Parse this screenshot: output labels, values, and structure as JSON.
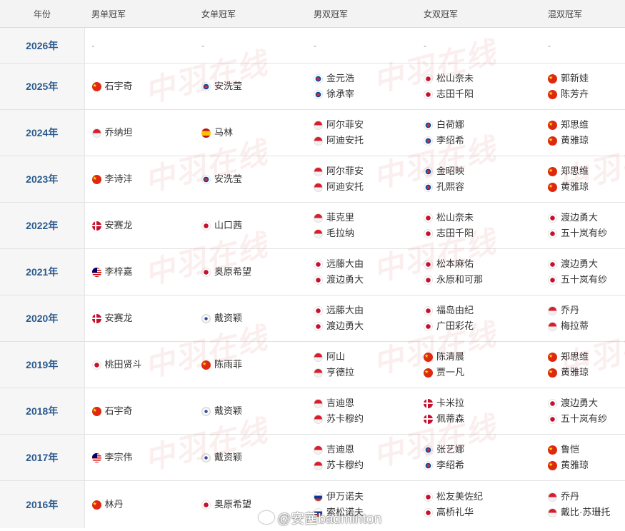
{
  "headers": [
    "年份",
    "男单冠军",
    "女单冠军",
    "男双冠军",
    "女双冠军",
    "混双冠军"
  ],
  "rows": [
    {
      "year": "2026年",
      "ms": "-",
      "ws": "-",
      "md": "-",
      "wd": "-",
      "xd": "-"
    },
    {
      "year": "2025年",
      "ms": {
        "flag": "cn",
        "name": "石宇奇"
      },
      "ws": {
        "flag": "kr",
        "name": "安洗莹"
      },
      "md": [
        {
          "flag": "kr",
          "name": "金元浩"
        },
        {
          "flag": "kr",
          "name": "徐承宰"
        }
      ],
      "wd": [
        {
          "flag": "jp",
          "name": "松山奈未"
        },
        {
          "flag": "jp",
          "name": "志田千阳"
        }
      ],
      "xd": [
        {
          "flag": "cn",
          "name": "郭新娃"
        },
        {
          "flag": "cn",
          "name": "陈芳卉"
        }
      ]
    },
    {
      "year": "2024年",
      "ms": {
        "flag": "id",
        "name": "乔纳坦"
      },
      "ws": {
        "flag": "es",
        "name": "马林"
      },
      "md": [
        {
          "flag": "id",
          "name": "阿尔菲安"
        },
        {
          "flag": "id",
          "name": "阿迪安托"
        }
      ],
      "wd": [
        {
          "flag": "kr",
          "name": "白荷娜"
        },
        {
          "flag": "kr",
          "name": "李绍希"
        }
      ],
      "xd": [
        {
          "flag": "cn",
          "name": "郑思维"
        },
        {
          "flag": "cn",
          "name": "黄雅琼"
        }
      ]
    },
    {
      "year": "2023年",
      "ms": {
        "flag": "cn",
        "name": "李诗沣"
      },
      "ws": {
        "flag": "kr",
        "name": "安洗莹"
      },
      "md": [
        {
          "flag": "id",
          "name": "阿尔菲安"
        },
        {
          "flag": "id",
          "name": "阿迪安托"
        }
      ],
      "wd": [
        {
          "flag": "kr",
          "name": "金昭映"
        },
        {
          "flag": "kr",
          "name": "孔熙容"
        }
      ],
      "xd": [
        {
          "flag": "cn",
          "name": "郑思维"
        },
        {
          "flag": "cn",
          "name": "黄雅琼"
        }
      ]
    },
    {
      "year": "2022年",
      "ms": {
        "flag": "dk",
        "name": "安赛龙"
      },
      "ws": {
        "flag": "jp",
        "name": "山口茜"
      },
      "md": [
        {
          "flag": "id",
          "name": "菲克里"
        },
        {
          "flag": "id",
          "name": "毛拉纳"
        }
      ],
      "wd": [
        {
          "flag": "jp",
          "name": "松山奈未"
        },
        {
          "flag": "jp",
          "name": "志田千阳"
        }
      ],
      "xd": [
        {
          "flag": "jp",
          "name": "渡边勇大"
        },
        {
          "flag": "jp",
          "name": "五十岚有纱"
        }
      ]
    },
    {
      "year": "2021年",
      "ms": {
        "flag": "my",
        "name": "李梓嘉"
      },
      "ws": {
        "flag": "jp",
        "name": "奥原希望"
      },
      "md": [
        {
          "flag": "jp",
          "name": "远藤大由"
        },
        {
          "flag": "jp",
          "name": "渡边勇大"
        }
      ],
      "wd": [
        {
          "flag": "jp",
          "name": "松本麻佑"
        },
        {
          "flag": "jp",
          "name": "永原和可那"
        }
      ],
      "xd": [
        {
          "flag": "jp",
          "name": "渡边勇大"
        },
        {
          "flag": "jp",
          "name": "五十岚有纱"
        }
      ]
    },
    {
      "year": "2020年",
      "ms": {
        "flag": "dk",
        "name": "安赛龙"
      },
      "ws": {
        "flag": "tp",
        "name": "戴资颖"
      },
      "md": [
        {
          "flag": "jp",
          "name": "远藤大由"
        },
        {
          "flag": "jp",
          "name": "渡边勇大"
        }
      ],
      "wd": [
        {
          "flag": "jp",
          "name": "福岛由纪"
        },
        {
          "flag": "jp",
          "name": "广田彩花"
        }
      ],
      "xd": [
        {
          "flag": "id",
          "name": "乔丹"
        },
        {
          "flag": "id",
          "name": "梅拉蒂"
        }
      ]
    },
    {
      "year": "2019年",
      "ms": {
        "flag": "jp",
        "name": "桃田贤斗"
      },
      "ws": {
        "flag": "cn",
        "name": "陈雨菲"
      },
      "md": [
        {
          "flag": "id",
          "name": "阿山"
        },
        {
          "flag": "id",
          "name": "亨德拉"
        }
      ],
      "wd": [
        {
          "flag": "cn",
          "name": "陈清晨"
        },
        {
          "flag": "cn",
          "name": "贾一凡"
        }
      ],
      "xd": [
        {
          "flag": "cn",
          "name": "郑思维"
        },
        {
          "flag": "cn",
          "name": "黄雅琼"
        }
      ]
    },
    {
      "year": "2018年",
      "ms": {
        "flag": "cn",
        "name": "石宇奇"
      },
      "ws": {
        "flag": "tp",
        "name": "戴资颖"
      },
      "md": [
        {
          "flag": "id",
          "name": "吉迪恩"
        },
        {
          "flag": "id",
          "name": "苏卡穆约"
        }
      ],
      "wd": [
        {
          "flag": "dk",
          "name": "卡米拉"
        },
        {
          "flag": "dk",
          "name": "佩蒂森"
        }
      ],
      "xd": [
        {
          "flag": "jp",
          "name": "渡边勇大"
        },
        {
          "flag": "jp",
          "name": "五十岚有纱"
        }
      ]
    },
    {
      "year": "2017年",
      "ms": {
        "flag": "my",
        "name": "李宗伟"
      },
      "ws": {
        "flag": "tp",
        "name": "戴资颖"
      },
      "md": [
        {
          "flag": "id",
          "name": "吉迪恩"
        },
        {
          "flag": "id",
          "name": "苏卡穆约"
        }
      ],
      "wd": [
        {
          "flag": "kr",
          "name": "张艺娜"
        },
        {
          "flag": "kr",
          "name": "李绍希"
        }
      ],
      "xd": [
        {
          "flag": "cn",
          "name": "鲁恺"
        },
        {
          "flag": "cn",
          "name": "黄雅琼"
        }
      ]
    },
    {
      "year": "2016年",
      "ms": {
        "flag": "cn",
        "name": "林丹"
      },
      "ws": {
        "flag": "jp",
        "name": "奥原希望"
      },
      "md": [
        {
          "flag": "ru",
          "name": "伊万诺夫"
        },
        {
          "flag": "ru",
          "name": "索松诺夫"
        }
      ],
      "wd": [
        {
          "flag": "jp",
          "name": "松友美佐纪"
        },
        {
          "flag": "jp",
          "name": "高桥礼华"
        }
      ],
      "xd": [
        {
          "flag": "id",
          "name": "乔丹"
        },
        {
          "flag": "id",
          "name": "戴比·苏珊托"
        }
      ]
    }
  ],
  "watermark_text": "中羽在线",
  "weibo_handle": "@安茜badminton"
}
